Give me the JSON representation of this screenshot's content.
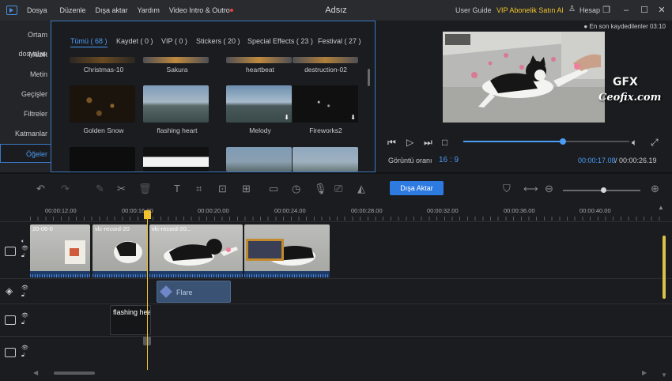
{
  "titlebar": {
    "menus": [
      "Dosya",
      "Düzenle",
      "Dışa aktar",
      "Yardım",
      "Video Intro & Outro"
    ],
    "title": "Adsız",
    "user_guide": "User Guide",
    "vip": "VIP Abonelik Satın Al",
    "account": "Hesap",
    "vip_color": "#f0c22c"
  },
  "left_nav": {
    "items": [
      "Ortam dosyaları",
      "Müzik",
      "Metin",
      "Geçişler",
      "Filtreler",
      "Katmanlar",
      "Öğeler"
    ],
    "active": "Öğeler"
  },
  "tabs": [
    "Tümü ( 68 )",
    "Kaydet ( 0 )",
    "VIP ( 0 )",
    "Stickers ( 20 )",
    "Special Effects ( 23 )",
    "Festival ( 27 )"
  ],
  "thumbnails": {
    "row1": [
      "Christmas-10",
      "Sakura",
      "heartbeat",
      "destruction-02"
    ],
    "row2": [
      "Golden Snow",
      "flashing heart",
      "Melody",
      "Fireworks2"
    ]
  },
  "preview": {
    "saved": "En son kaydedilenler 03:10",
    "aspect_label": "Görüntü oranı",
    "aspect_value": "16 : 9",
    "time_current": "00:00:17.08",
    "time_total": "00:00:26.19",
    "progress": 0.6,
    "watermark": "Ceofix.com",
    "watermark_logo": "GFX"
  },
  "toolbar": {
    "export": "Dışa Aktar",
    "zoom_level": 0.52,
    "accent": "#2d7ae0"
  },
  "ruler": [
    "00:00:12.00",
    "00:00:16.00",
    "00:00:20.00",
    "00:00:24.00",
    "00:00:28.00",
    "00:00:32.00",
    "00:00:36.00",
    "00:00:40.00"
  ],
  "timeline": {
    "clip_labels": [
      "20-06-0",
      "vlc-record-20",
      "vlc-record-20..."
    ],
    "overlay_clip": "Flare",
    "text_clip": "flashing hea"
  },
  "icons": {
    "watermark_logo": "gfx-logo"
  }
}
